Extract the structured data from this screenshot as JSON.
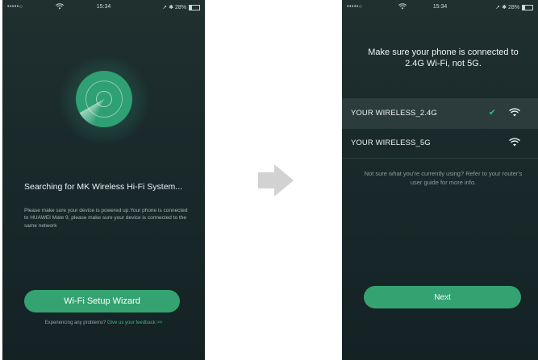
{
  "left_screen": {
    "status": {
      "signal": "•••••○",
      "time": "15:34",
      "battery": "28%"
    },
    "search_title": "Searching for MK Wireless Hi-Fi System...",
    "search_desc": "Please make sure your device is powered up.Your phone is connected to HUAWEI Mate 9, please make sure your device is connected to the same network",
    "wizard_button": "Wi-Fi Setup Wizard",
    "feedback_text": "Experiencing any problems?",
    "feedback_link": "Give us your feedback >>"
  },
  "right_screen": {
    "status": {
      "signal": "•••••○",
      "time": "15:34",
      "battery": "28%"
    },
    "make_sure": "Make sure your phone is connected to 2.4G Wi-Fi, not 5G.",
    "networks": [
      {
        "name": "YOUR WIRELESS_2.4G",
        "selected": true
      },
      {
        "name": "YOUR WIRELESS_5G",
        "selected": false
      }
    ],
    "not_sure": "Not sure what you're currently using? Refer to your router's user guide for more info.",
    "next_button": "Next"
  },
  "colors": {
    "accent": "#34a271",
    "background": "#1a2a2b",
    "check": "#2fb87a"
  },
  "icons": [
    "wifi-icon",
    "checkmark-icon",
    "radar-icon",
    "arrow-right-icon",
    "bluetooth-icon",
    "location-icon"
  ]
}
